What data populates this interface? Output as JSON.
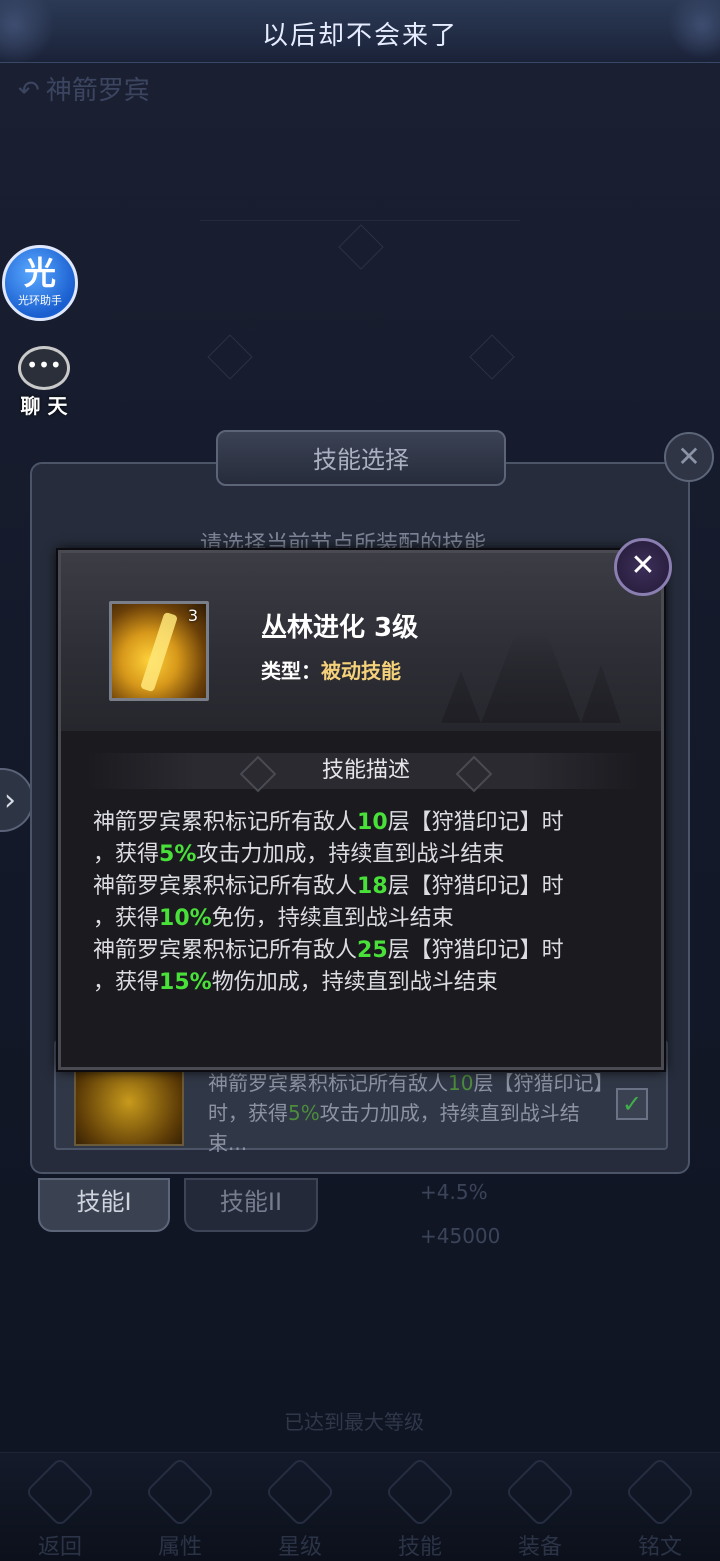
{
  "top_banner": {
    "title": "以后却不会来了"
  },
  "hero": {
    "name": "神箭罗宾"
  },
  "left_buttons": {
    "assist_big": "光",
    "assist_small": "光环助手",
    "chat_icon": "•••",
    "chat_label": "聊 天",
    "expand_arrow": "›"
  },
  "skill_select": {
    "title": "技能选择",
    "close": "✕",
    "hint": "请选择当前节点所装配的技能",
    "card": {
      "desc_prefix": "神箭罗宾累积标记所有敌人",
      "desc_num1": "10",
      "desc_mid": "层【狩猎印记】时，获得",
      "desc_num2": "5%",
      "desc_suffix": "攻击力加成，持续直到战斗结束...",
      "check": "✓"
    },
    "tabs": [
      "技能I",
      "技能II"
    ]
  },
  "underlay": {
    "val1": "+4.5%",
    "val2": "+45000",
    "max_level": "已达到最大等级"
  },
  "bottom_nav": [
    "返回",
    "属性",
    "星级",
    "技能",
    "装备",
    "铭文"
  ],
  "popup": {
    "skill_name": "丛林进化 3级",
    "skill_level_badge": "3",
    "type_label": "类型：",
    "type_value": "被动技能",
    "desc_title": "技能描述",
    "close": "✕",
    "lines": [
      {
        "a": "神箭罗宾累积标记所有敌人",
        "n": "10",
        "b": "层【狩猎印记】时"
      },
      {
        "a": "，获得",
        "n": "5%",
        "b": "攻击力加成，持续直到战斗结束"
      },
      {
        "a": "神箭罗宾累积标记所有敌人",
        "n": "18",
        "b": "层【狩猎印记】时"
      },
      {
        "a": "，获得",
        "n": "10%",
        "b": "免伤，持续直到战斗结束"
      },
      {
        "a": "神箭罗宾累积标记所有敌人",
        "n": "25",
        "b": "层【狩猎印记】时"
      },
      {
        "a": "，获得",
        "n": "15%",
        "b": "物伤加成，持续直到战斗结束"
      }
    ]
  },
  "colors": {
    "highlight_green": "#49e03a",
    "type_gold": "#f5d27a",
    "assist_blue": "#1a5fd0"
  },
  "icons": [
    "back-arrow-icon",
    "close-icon",
    "check-icon",
    "chevron-right-icon",
    "chat-bubble-icon"
  ]
}
